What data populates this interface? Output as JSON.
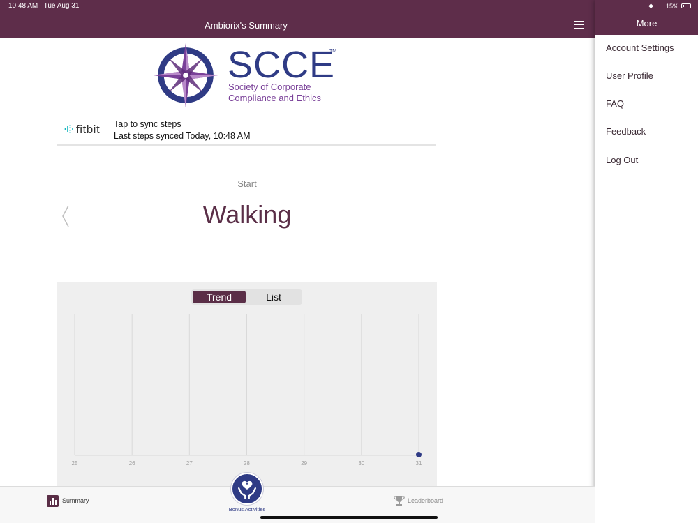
{
  "status_bar": {
    "time": "10:48 AM",
    "date": "Tue Aug 31",
    "battery": "15%"
  },
  "header": {
    "title": "Ambiorix's Summary",
    "menu_icon": "hamburger-icon"
  },
  "drawer": {
    "title": "More",
    "items": [
      {
        "label": "Account Settings"
      },
      {
        "label": "User Profile"
      },
      {
        "label": "FAQ"
      },
      {
        "label": "Feedback"
      },
      {
        "label": "Log Out"
      }
    ]
  },
  "logo": {
    "name": "SCCE",
    "trademark": "TM",
    "subtitle_line1": "Society of Corporate",
    "subtitle_line2": "Compliance and Ethics"
  },
  "fitbit": {
    "brand": "fitbit",
    "tap_text": "Tap to sync steps",
    "last_sync": "Last steps synced Today, 10:48 AM"
  },
  "activity": {
    "start_label": "Start",
    "name": "Walking"
  },
  "chart": {
    "toggle": {
      "active": "Trend",
      "options": [
        "Trend",
        "List"
      ]
    }
  },
  "chart_data": {
    "type": "scatter",
    "x_ticks": [
      "25",
      "26",
      "27",
      "28",
      "29",
      "30",
      "31"
    ],
    "points": [
      {
        "x": "31",
        "y": 0
      }
    ],
    "point_color": "#2f3b85",
    "grid": true
  },
  "tabbar": {
    "summary": "Summary",
    "bonus": "Bonus Activities",
    "leaderboard": "Leaderboard"
  },
  "colors": {
    "brand": "#5e2d4a",
    "accent": "#2f3b85",
    "logo_purple": "#7a4199"
  }
}
